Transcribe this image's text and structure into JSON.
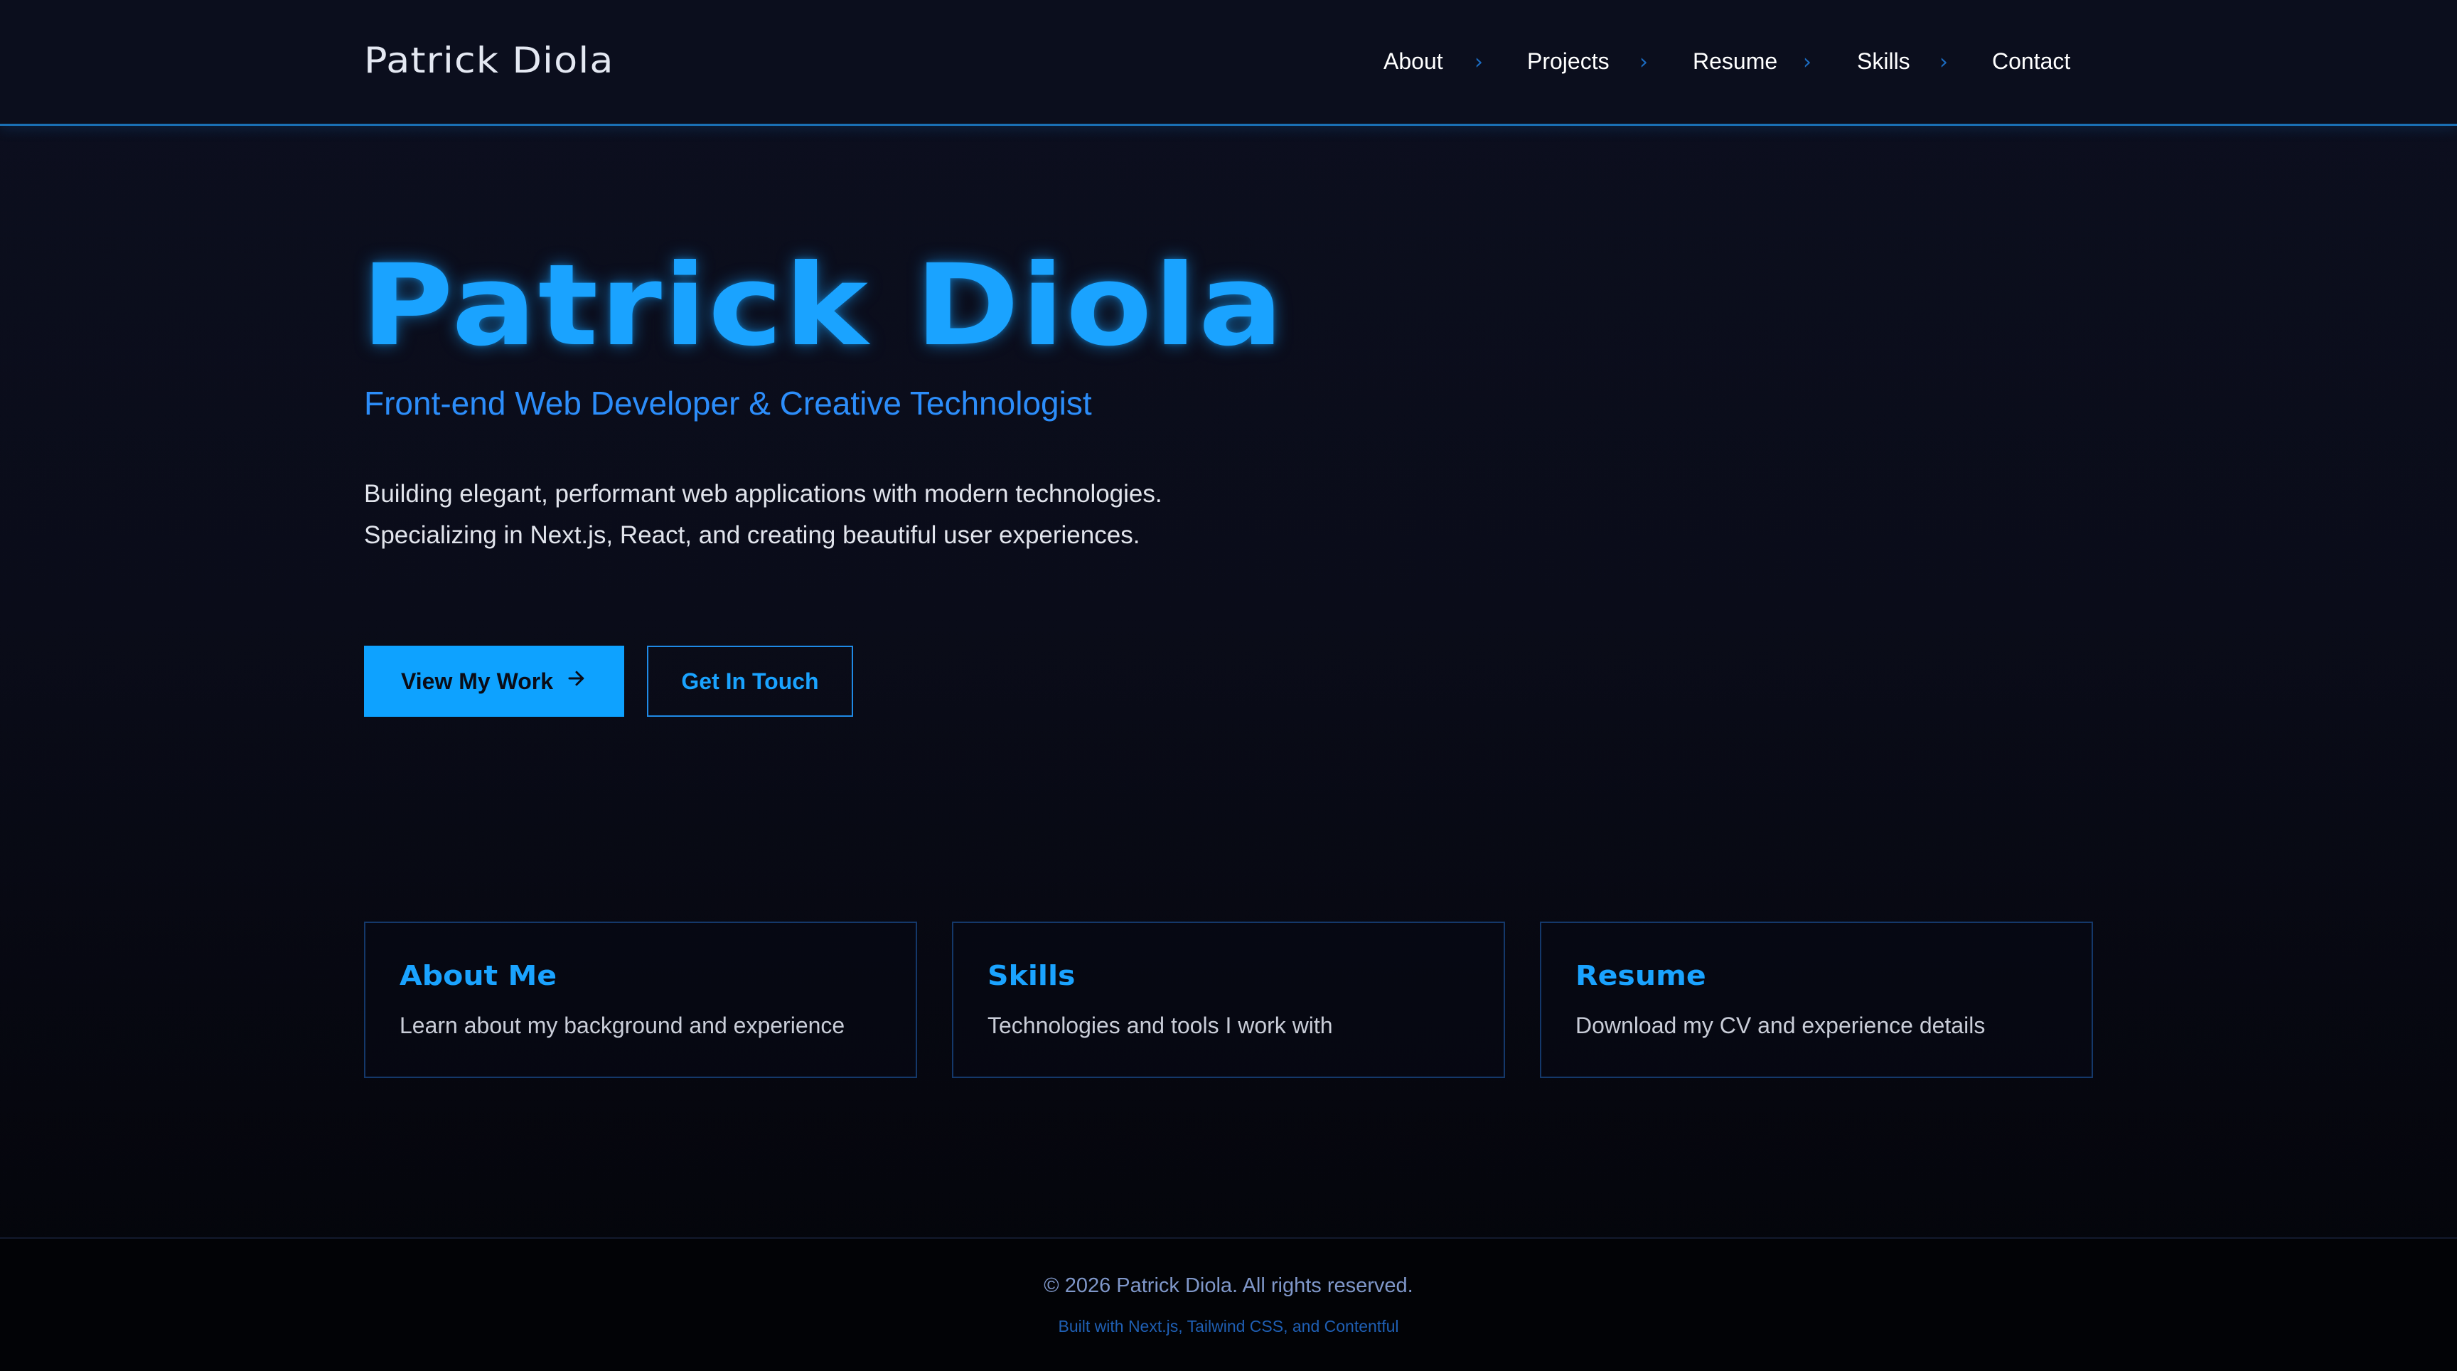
{
  "header": {
    "brand": "Patrick Diola",
    "nav": [
      {
        "label": "About"
      },
      {
        "label": "Projects"
      },
      {
        "label": "Resume"
      },
      {
        "label": "Skills"
      },
      {
        "label": "Contact"
      }
    ],
    "separator": "›"
  },
  "hero": {
    "title": "Patrick Diola",
    "subtitle": "Front-end Web Developer & Creative Technologist",
    "description_line1": "Building elegant, performant web applications with modern technologies.",
    "description_line2": "Specializing in Next.js, React, and creating beautiful user experiences.",
    "primary_button": "View My Work",
    "primary_button_icon": "arrow-right-icon",
    "secondary_button": "Get In Touch"
  },
  "cards": [
    {
      "title": "About Me",
      "description": "Learn about my background and experience"
    },
    {
      "title": "Skills",
      "description": "Technologies and tools I work with"
    },
    {
      "title": "Resume",
      "description": "Download my CV and experience details"
    }
  ],
  "footer": {
    "copyright": "© 2026 Patrick Diola. All rights reserved.",
    "built_with": "Built with Next.js, Tailwind CSS, and Contentful"
  },
  "colors": {
    "accent": "#1aa3ff",
    "background": "#0a0c19",
    "primary_button_bg": "#0ea2ff",
    "subtitle": "#2c8dfa"
  }
}
